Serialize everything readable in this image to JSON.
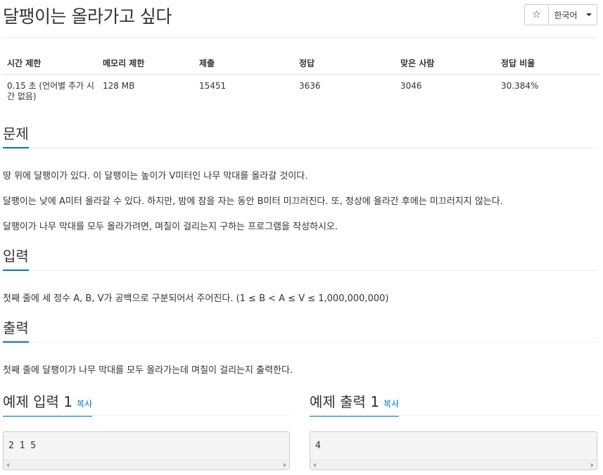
{
  "problem": {
    "title": "달팽이는 올라가고 싶다"
  },
  "toolbar": {
    "star_icon": "☆",
    "language_label": "한국어"
  },
  "stats": {
    "headers": [
      "시간 제한",
      "메모리 제한",
      "제출",
      "정답",
      "맞은 사람",
      "정답 비율"
    ],
    "time_limit_line1": "0.15 초 (언어별 추가 시",
    "time_limit_line2": "간 없음)",
    "memory_limit": "128 MB",
    "submissions": "15451",
    "accepted": "3636",
    "solved_users": "3046",
    "accept_ratio": "30.384%"
  },
  "sections": {
    "problem_title": "문제",
    "problem_lines": [
      "땅 위에 달팽이가 있다. 이 달팽이는 높이가 V미터인 나무 막대를 올라갈 것이다.",
      "달팽이는 낮에 A미터 올라갈 수 있다. 하지만, 밤에 잠을 자는 동안 B미터 미끄러진다. 또, 정상에 올라간 후에는 미끄러지지 않는다.",
      "달팽이가 나무 막대를 모두 올라가려면, 며칠이 걸리는지 구하는 프로그램을 작성하시오."
    ],
    "input_title": "입력",
    "input_text": "첫째 줄에 세 정수 A, B, V가 공백으로 구분되어서 주어진다. (1 ≤ B < A ≤ V ≤ 1,000,000,000)",
    "output_title": "출력",
    "output_text": "첫째 줄에 달팽이가 나무 막대를 모두 올라가는데 며칠이 걸리는지 출력한다."
  },
  "samples": {
    "input_title": "예제 입력 1",
    "output_title": "예제 출력 1",
    "copy_label": "복사",
    "input_value": "2 1 5",
    "output_value": "4"
  }
}
